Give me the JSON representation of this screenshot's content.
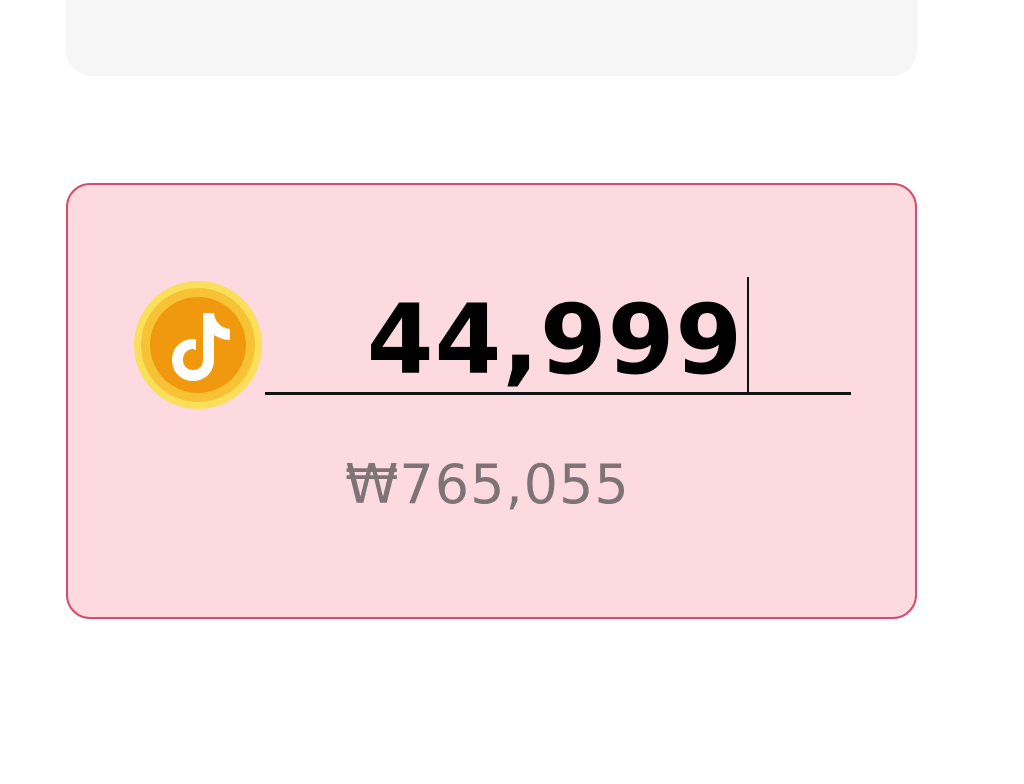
{
  "coin_input": {
    "amount": "44,999",
    "converted_value": "₩765,055"
  },
  "colors": {
    "card_background": "#fdd9e0",
    "card_border": "#d94b6e",
    "coin_outer": "#f7c733",
    "coin_inner": "#f09a13",
    "converted_text": "#7e7478"
  },
  "icons": {
    "coin": "tiktok-coin-icon"
  }
}
